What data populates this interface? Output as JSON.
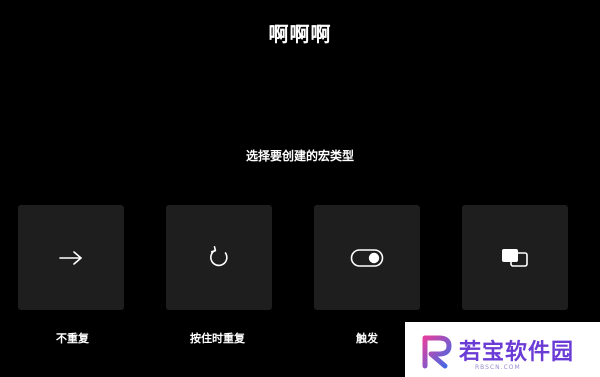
{
  "header": {
    "title": "啊啊啊",
    "subtitle": "选择要创建的宏类型"
  },
  "options": [
    {
      "label": "不重复",
      "icon": "arrow-right-icon"
    },
    {
      "label": "按住时重复",
      "icon": "rotate-icon"
    },
    {
      "label": "触发",
      "icon": "toggle-icon"
    },
    {
      "label": "",
      "icon": "copy-squares-icon"
    }
  ],
  "watermark": {
    "text": "若宝软件园",
    "subtext": "RBSCN.COM"
  },
  "colors": {
    "background": "#000000",
    "card": "#1e1e1e",
    "text": "#ffffff",
    "watermark_accent": "#6b3bd6"
  }
}
